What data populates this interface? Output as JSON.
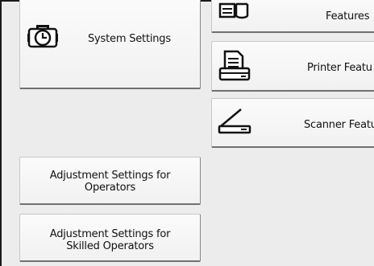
{
  "left_column": {
    "system_settings": {
      "label": "System Settings",
      "icon": "clock-toolbox-icon"
    },
    "adjust_operators": {
      "label": "Adjustment Settings for\nOperators"
    },
    "adjust_skilled": {
      "label": "Adjustment Settings for\nSkilled Operators"
    }
  },
  "right_column": {
    "features": {
      "label": "Features",
      "icon": "database-icon"
    },
    "printer_features": {
      "label": "Printer Featu",
      "icon": "printer-icon"
    },
    "scanner_features": {
      "label": "Scanner Featu",
      "icon": "scanner-icon"
    }
  }
}
